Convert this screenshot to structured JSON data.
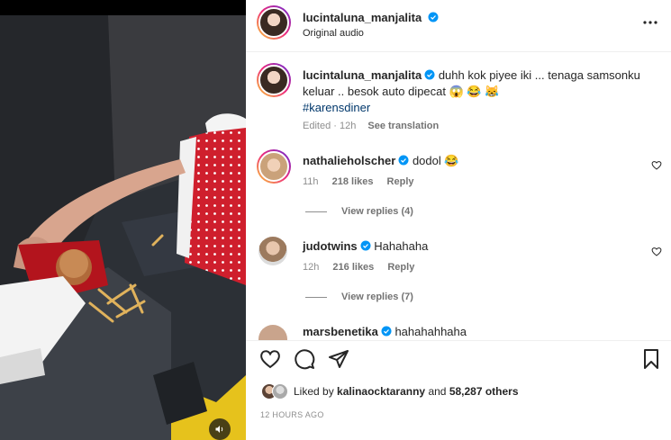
{
  "post": {
    "author": "lucintaluna_manjalita",
    "audio": "Original audio"
  },
  "caption": {
    "username": "lucintaluna_manjalita",
    "text": "duhh kok piyee iki ... tenaga samsonku keluar .. besok auto dipecat 😱 😂 😹",
    "hashtag": "#karensdiner",
    "edited": "Edited · 12h",
    "see_translation": "See translation"
  },
  "comments": [
    {
      "username": "nathalieholscher",
      "text": "dodol 😂",
      "time": "11h",
      "likes": "218 likes",
      "reply": "Reply",
      "view_replies": "View replies (4)"
    },
    {
      "username": "judotwins",
      "text": "Hahahaha",
      "time": "12h",
      "likes": "216 likes",
      "reply": "Reply",
      "view_replies": "View replies (7)"
    },
    {
      "username": "marsbenetika",
      "text": "hahahahhaha"
    }
  ],
  "likes": {
    "prefix": "Liked by",
    "user": "kalinaocktaranny",
    "and": "and",
    "others": "58,287 others"
  },
  "timestamp": "12 HOURS AGO",
  "icons": {
    "verified": "verified-badge-icon",
    "more": "more-options-icon",
    "heart": "heart-icon",
    "comment": "comment-icon",
    "share": "share-icon",
    "save": "bookmark-icon",
    "mute": "speaker-icon"
  },
  "colors": {
    "verified": "#0095f6",
    "hashtag": "#00376b",
    "muted_text": "#8e8e8e"
  }
}
